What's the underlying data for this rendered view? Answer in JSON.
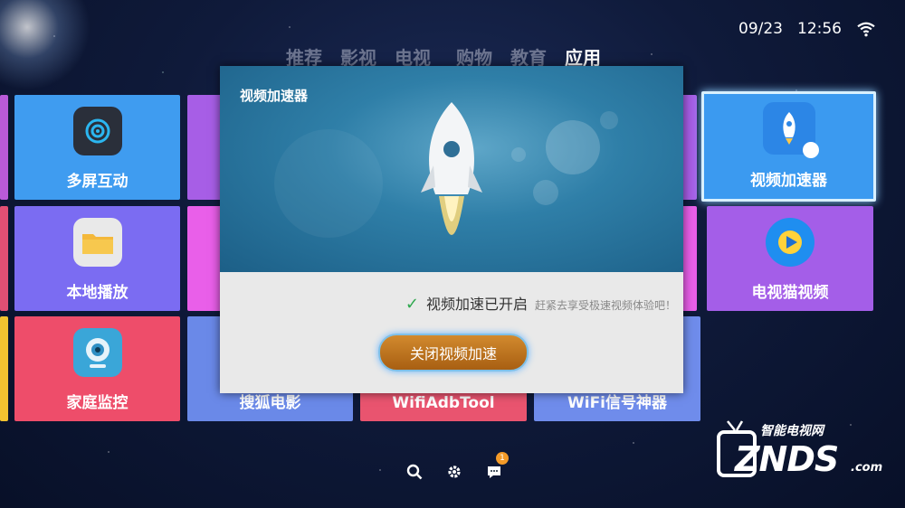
{
  "status": {
    "date": "09/23",
    "time": "12:56"
  },
  "nav": {
    "tabs": [
      "推荐",
      "影视",
      "电视",
      "购物",
      "教育",
      "应用"
    ],
    "active_index": 5
  },
  "tiles": {
    "multi_screen": "多屏互动",
    "local_play": "本地播放",
    "home_monitor": "家庭监控",
    "video_accel": "视频加速器",
    "tv_cat": "电视猫视频",
    "sohu": "搜狐电影",
    "wifiadb": "WifiAdbTool",
    "wifi_signal": "WiFi信号神器"
  },
  "dialog": {
    "title": "视频加速器",
    "status_main": "视频加速已开启",
    "status_sub": "赶紧去享受极速视频体验吧！",
    "button": "关闭视频加速"
  },
  "dock": {
    "badge_count": "1"
  },
  "watermark": {
    "cn": "智能电视网",
    "en": "ZNDS",
    "domain": ".com"
  },
  "colors": {
    "accent": "#c7781f",
    "focus": "#9fd6ff",
    "check": "#2fa84f"
  }
}
